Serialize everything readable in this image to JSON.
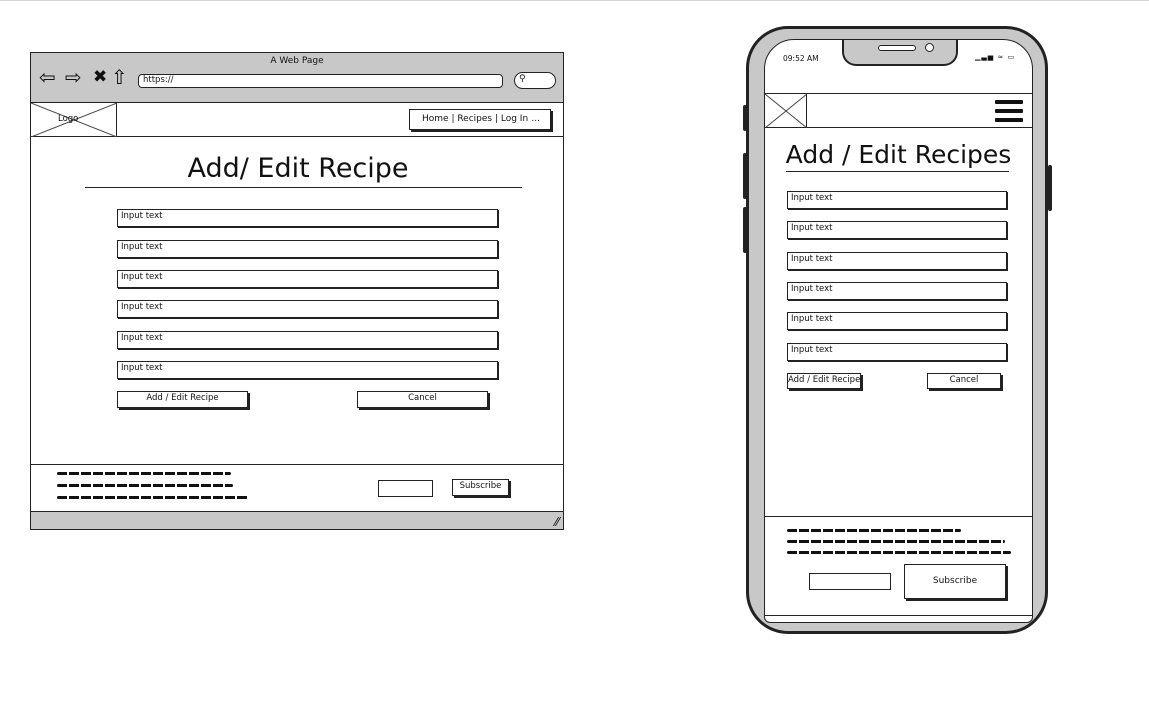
{
  "desktop": {
    "window_title": "A Web Page",
    "nav_icons": [
      "back-arrow-icon",
      "forward-arrow-icon",
      "close-icon",
      "home-icon"
    ],
    "url": "https://",
    "logo_label": "Logo",
    "nav_links": "Home | Recipes | Log In",
    "nav_more": "...",
    "heading": "Add/ Edit Recipe",
    "inputs": [
      "Input text",
      "Input text",
      "Input text",
      "Input text",
      "Input text",
      "Input text"
    ],
    "submit_label": "Add / Edit Recipe",
    "cancel_label": "Cancel",
    "subscribe_label": "Subscribe"
  },
  "mobile": {
    "time": "09:52 AM",
    "heading": "Add / Edit Recipes",
    "inputs": [
      "Input text",
      "Input text",
      "Input text",
      "Input text",
      "Input text",
      "Input text"
    ],
    "submit_label": "Add / Edit Recipe",
    "cancel_label": "Cancel",
    "subscribe_label": "Subscribe"
  },
  "colors": {
    "chrome_gray": "#c8c8c8",
    "stroke": "#222222",
    "background": "#ffffff"
  }
}
